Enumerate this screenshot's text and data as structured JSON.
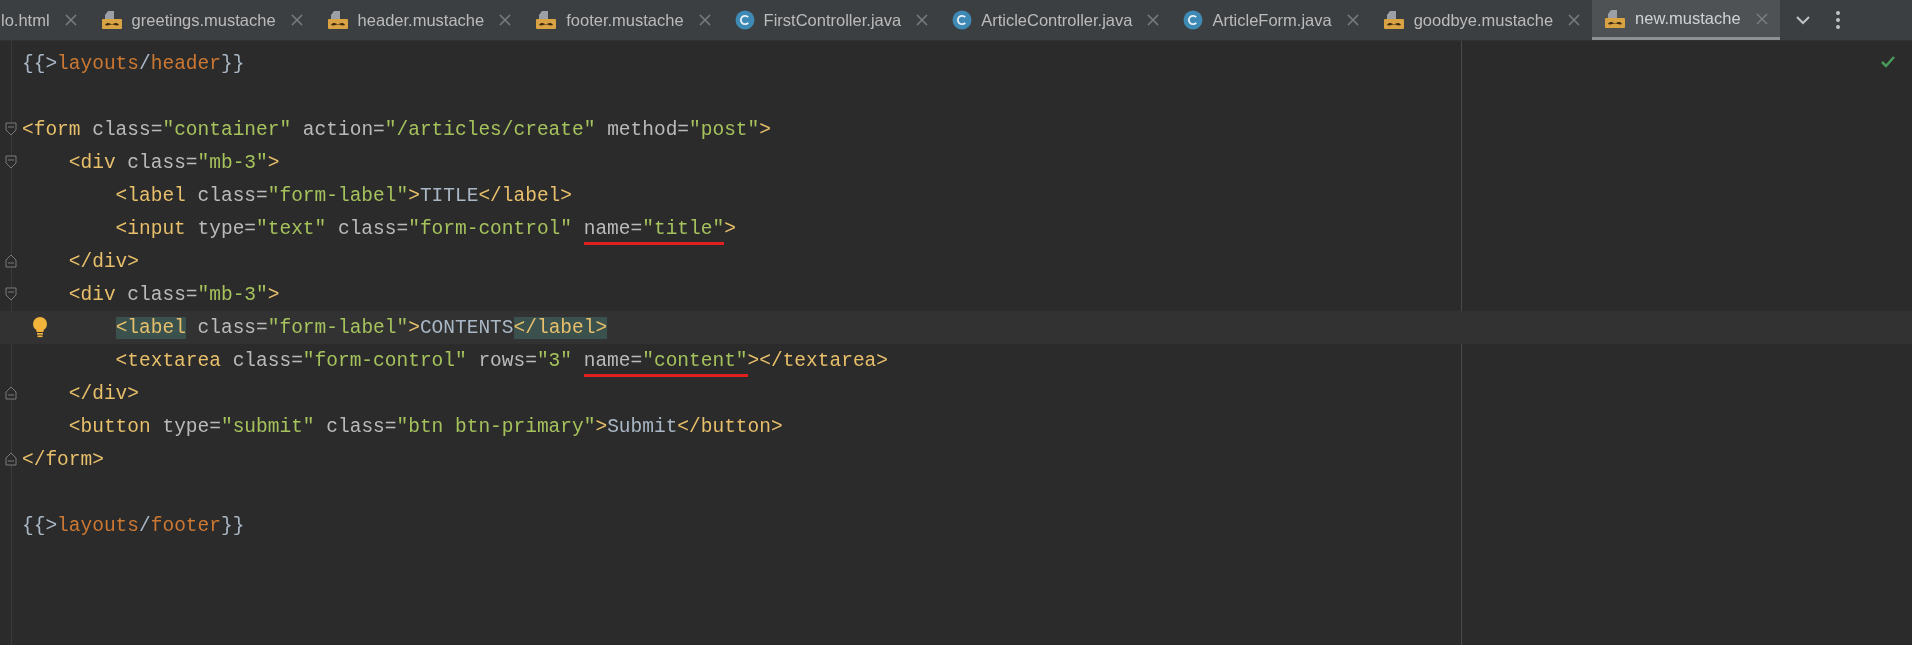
{
  "tabs": [
    {
      "label": "lo.html",
      "kind": "cut",
      "selected": false
    },
    {
      "label": "greetings.mustache",
      "kind": "mustache",
      "selected": false
    },
    {
      "label": "header.mustache",
      "kind": "mustache",
      "selected": false
    },
    {
      "label": "footer.mustache",
      "kind": "mustache",
      "selected": false
    },
    {
      "label": "FirstController.java",
      "kind": "java",
      "selected": false
    },
    {
      "label": "ArticleController.java",
      "kind": "java",
      "selected": false
    },
    {
      "label": "ArticleForm.java",
      "kind": "java",
      "selected": false
    },
    {
      "label": "goodbye.mustache",
      "kind": "mustache",
      "selected": false
    },
    {
      "label": "new.mustache",
      "kind": "mustache",
      "selected": true
    }
  ],
  "editor": {
    "lines": [
      {
        "fold_open": false,
        "fold_close": false,
        "current": false,
        "bulb": false,
        "tokens": [
          {
            "text": "{{>",
            "kind": "plain"
          },
          {
            "text": "layouts",
            "kind": "path"
          },
          {
            "text": "/",
            "kind": "plain"
          },
          {
            "text": "header",
            "kind": "path"
          },
          {
            "text": "}}",
            "kind": "plain"
          }
        ]
      },
      {
        "fold_open": false,
        "fold_close": false,
        "current": false,
        "bulb": false
      },
      {
        "fold_open": true,
        "fold_close": false,
        "current": false,
        "bulb": false,
        "tokens": [
          {
            "text": "<form",
            "kind": "tag"
          },
          {
            "text": " class=",
            "kind": "attr"
          },
          {
            "text": "\"container\"",
            "kind": "value"
          },
          {
            "text": " action=",
            "kind": "attr"
          },
          {
            "text": "\"/articles/create\"",
            "kind": "value"
          },
          {
            "text": " method=",
            "kind": "attr"
          },
          {
            "text": "\"post\"",
            "kind": "value"
          },
          {
            "text": ">",
            "kind": "tag"
          }
        ]
      },
      {
        "fold_open": true,
        "fold_close": false,
        "current": false,
        "bulb": false,
        "tokens": [
          {
            "text": "    <div",
            "kind": "tag"
          },
          {
            "text": " class=",
            "kind": "attr"
          },
          {
            "text": "\"mb-3\"",
            "kind": "value"
          },
          {
            "text": ">",
            "kind": "tag"
          }
        ]
      },
      {
        "fold_open": false,
        "fold_close": false,
        "current": false,
        "bulb": false,
        "tokens": [
          {
            "text": "        <label",
            "kind": "tag"
          },
          {
            "text": " class=",
            "kind": "attr"
          },
          {
            "text": "\"form-label\"",
            "kind": "value"
          },
          {
            "text": ">",
            "kind": "tag"
          },
          {
            "text": "TITLE",
            "kind": "plain"
          },
          {
            "text": "</label>",
            "kind": "tag"
          }
        ]
      },
      {
        "fold_open": false,
        "fold_close": false,
        "current": false,
        "bulb": false,
        "tokens": [
          {
            "text": "        <input",
            "kind": "tag"
          },
          {
            "text": " type=",
            "kind": "attr"
          },
          {
            "text": "\"text\"",
            "kind": "value"
          },
          {
            "text": " class=",
            "kind": "attr"
          },
          {
            "text": "\"form-control\"",
            "kind": "value"
          },
          {
            "text": " name=",
            "kind": "attr",
            "underlined": true
          },
          {
            "text": "\"title\"",
            "kind": "value",
            "underlined": true
          },
          {
            "text": ">",
            "kind": "tag"
          }
        ]
      },
      {
        "fold_open": false,
        "fold_close": true,
        "current": false,
        "bulb": false,
        "tokens": [
          {
            "text": "    </div>",
            "kind": "tag"
          }
        ]
      },
      {
        "fold_open": true,
        "fold_close": false,
        "current": false,
        "bulb": false,
        "tokens": [
          {
            "text": "    <div",
            "kind": "tag"
          },
          {
            "text": " class=",
            "kind": "attr"
          },
          {
            "text": "\"mb-3\"",
            "kind": "value"
          },
          {
            "text": ">",
            "kind": "tag"
          }
        ]
      },
      {
        "fold_open": false,
        "fold_close": false,
        "current": true,
        "bulb": true,
        "tokens": [
          {
            "text": "        <label",
            "kind": "tag",
            "highlighted": true
          },
          {
            "text": " class=",
            "kind": "attr"
          },
          {
            "text": "\"form-label\"",
            "kind": "value"
          },
          {
            "text": ">",
            "kind": "tag"
          },
          {
            "text": "CONTENTS",
            "kind": "plain"
          },
          {
            "text": "</label>",
            "kind": "tag",
            "highlighted": true
          }
        ]
      },
      {
        "fold_open": false,
        "fold_close": false,
        "current": false,
        "bulb": false,
        "tokens": [
          {
            "text": "        <textarea",
            "kind": "tag"
          },
          {
            "text": " class=",
            "kind": "attr"
          },
          {
            "text": "\"form-control\"",
            "kind": "value"
          },
          {
            "text": " rows=",
            "kind": "attr"
          },
          {
            "text": "\"3\"",
            "kind": "value"
          },
          {
            "text": " name=",
            "kind": "attr",
            "underlined": true
          },
          {
            "text": "\"content\"",
            "kind": "value",
            "underlined": true
          },
          {
            "text": "></textarea>",
            "kind": "tag"
          }
        ]
      },
      {
        "fold_open": false,
        "fold_close": true,
        "current": false,
        "bulb": false,
        "tokens": [
          {
            "text": "    </div>",
            "kind": "tag"
          }
        ]
      },
      {
        "fold_open": false,
        "fold_close": false,
        "current": false,
        "bulb": false,
        "tokens": [
          {
            "text": "    <button",
            "kind": "tag"
          },
          {
            "text": " type=",
            "kind": "attr"
          },
          {
            "text": "\"submit\"",
            "kind": "value"
          },
          {
            "text": " class=",
            "kind": "attr"
          },
          {
            "text": "\"btn btn-primary\"",
            "kind": "value"
          },
          {
            "text": ">",
            "kind": "tag"
          },
          {
            "text": "Submit",
            "kind": "plain"
          },
          {
            "text": "</button>",
            "kind": "tag"
          }
        ]
      },
      {
        "fold_open": false,
        "fold_close": true,
        "current": false,
        "bulb": false,
        "tokens": [
          {
            "text": "</form>",
            "kind": "tag"
          }
        ]
      },
      {
        "fold_open": false,
        "fold_close": false,
        "current": false,
        "bulb": false
      },
      {
        "fold_open": false,
        "fold_close": false,
        "current": false,
        "bulb": false,
        "tokens": [
          {
            "text": "{{>",
            "kind": "plain"
          },
          {
            "text": "layouts",
            "kind": "path"
          },
          {
            "text": "/",
            "kind": "plain"
          },
          {
            "text": "footer",
            "kind": "path"
          },
          {
            "text": "}}",
            "kind": "plain"
          }
        ]
      }
    ]
  }
}
